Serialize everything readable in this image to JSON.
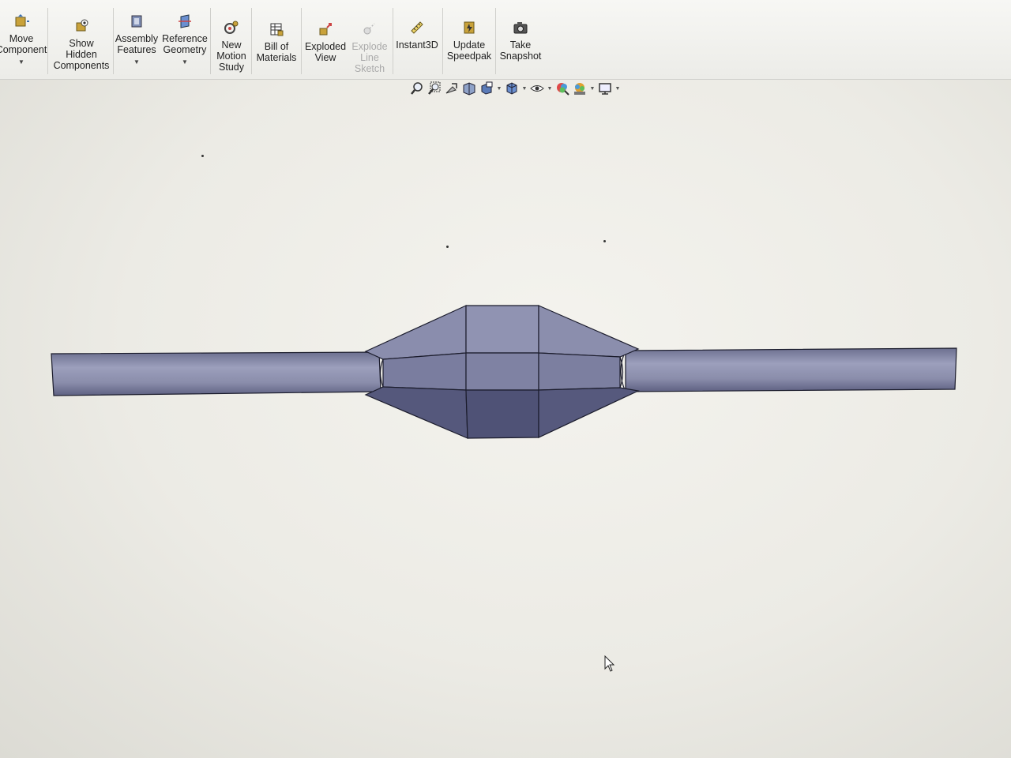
{
  "toolbar": {
    "move_component": {
      "label": "Move\nComponent",
      "icon": "move-component-icon"
    },
    "show_hidden": {
      "label": "Show\nHidden\nComponents",
      "icon": "show-hidden-icon"
    },
    "assembly_features": {
      "label": "Assembly\nFeatures",
      "icon": "assembly-features-icon"
    },
    "reference_geometry": {
      "label": "Reference\nGeometry",
      "icon": "reference-geometry-icon"
    },
    "new_motion_study": {
      "label": "New\nMotion\nStudy",
      "icon": "motion-study-icon"
    },
    "bill_of_materials": {
      "label": "Bill of\nMaterials",
      "icon": "bom-icon"
    },
    "exploded_view": {
      "label": "Exploded\nView",
      "icon": "exploded-view-icon"
    },
    "explode_line_sketch": {
      "label": "Explode\nLine\nSketch",
      "icon": "explode-line-icon"
    },
    "instant3d": {
      "label": "Instant3D",
      "icon": "instant3d-icon"
    },
    "update_speedpak": {
      "label": "Update\nSpeedpak",
      "icon": "speedpak-icon"
    },
    "take_snapshot": {
      "label": "Take\nSnapshot",
      "icon": "camera-icon"
    }
  },
  "heads_up_toolbar": [
    "zoom-to-fit-icon",
    "zoom-area-icon",
    "previous-view-icon",
    "section-view-icon",
    "view-orientation-icon",
    "display-style-icon",
    "hide-show-icon",
    "edit-appearance-icon",
    "apply-scene-icon",
    "view-settings-icon"
  ],
  "colors": {
    "model_face_light": "#8d90b0",
    "model_face_mid": "#6f7297",
    "model_face_dark": "#4d5074",
    "edge": "#1b1c2c",
    "canvas": "#efeee9"
  }
}
